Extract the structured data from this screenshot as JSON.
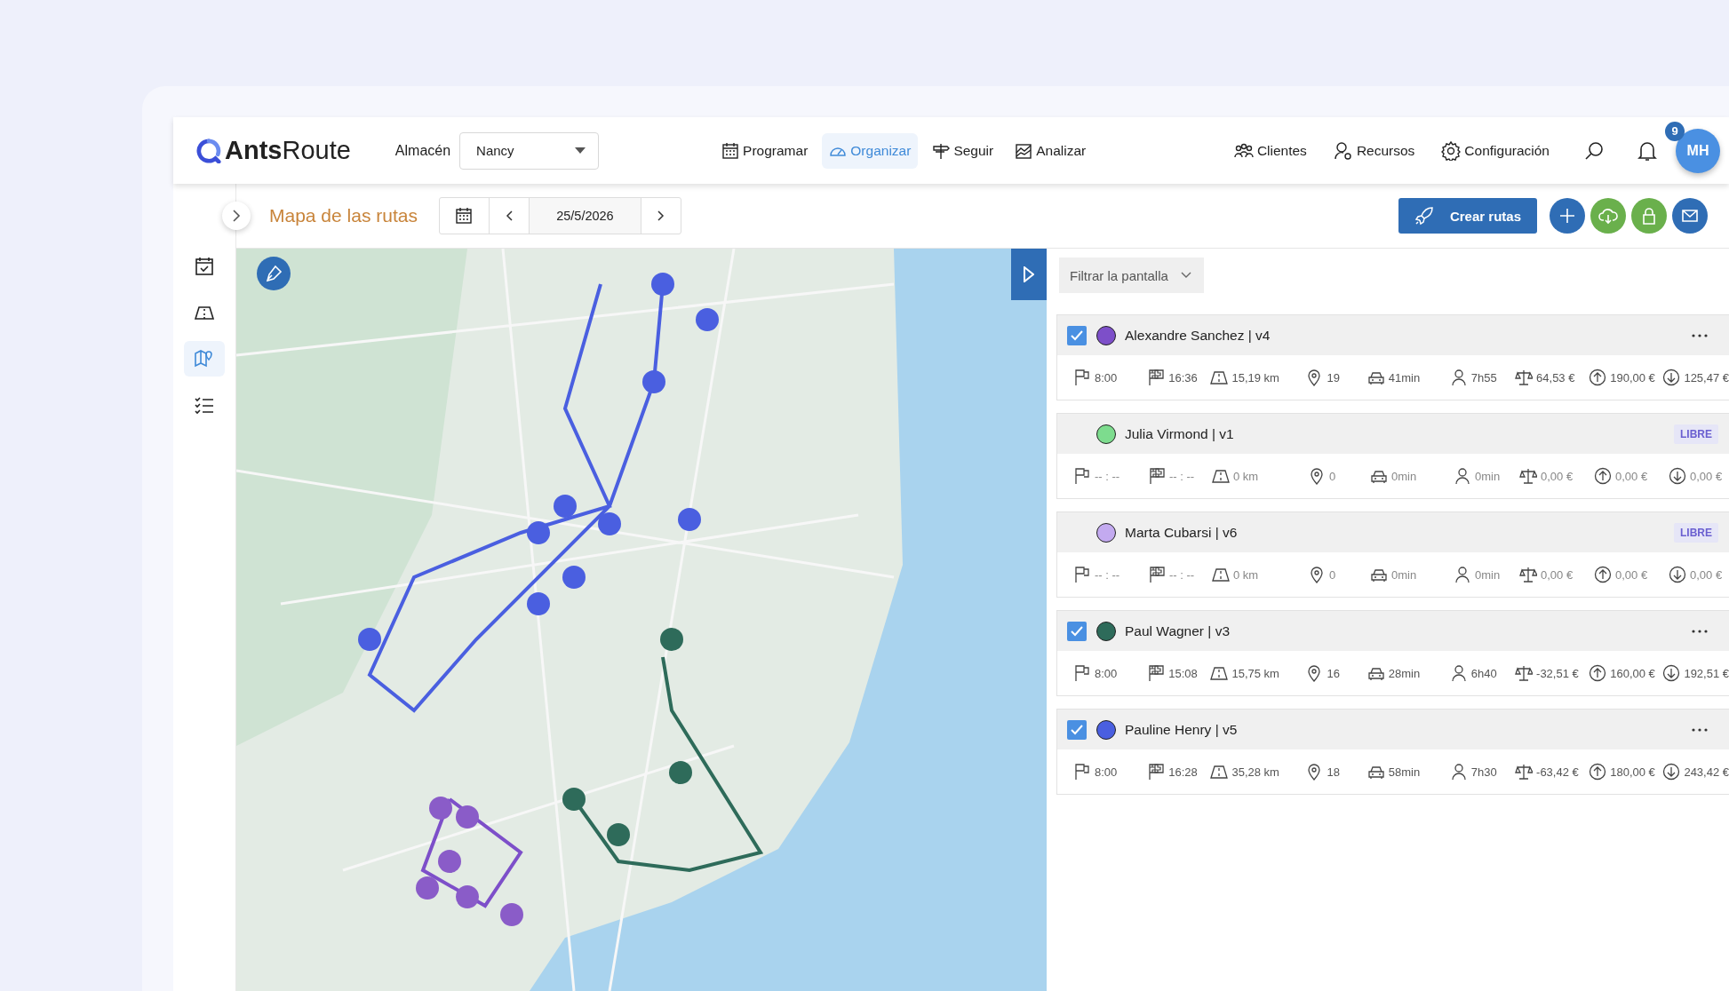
{
  "header": {
    "logo": {
      "strong": "Ants",
      "light": "Route"
    },
    "warehouse_label": "Almacén",
    "warehouse_select": "Nancy",
    "nav": [
      {
        "kind": "calendar",
        "label": "Programar",
        "selected": false
      },
      {
        "kind": "gauge",
        "label": "Organizar",
        "selected": true
      },
      {
        "kind": "signpost",
        "label": "Seguir",
        "selected": false
      },
      {
        "kind": "chart",
        "label": "Analizar",
        "selected": false
      }
    ],
    "right_nav": [
      {
        "kind": "people",
        "label": "Clientes"
      },
      {
        "kind": "user-gear",
        "label": "Recursos"
      },
      {
        "kind": "gear",
        "label": "Configuración"
      }
    ],
    "notifications": "9",
    "avatar": "MH"
  },
  "sidebar": {
    "items": [
      {
        "kind": "calendar-check",
        "selected": false
      },
      {
        "kind": "road",
        "selected": false
      },
      {
        "kind": "map",
        "selected": true
      },
      {
        "kind": "checklist",
        "selected": false
      }
    ]
  },
  "toolbar": {
    "title": "Mapa de las rutas",
    "date": "25/5/2026",
    "create_button": "Crear rutas",
    "actions": [
      {
        "kind": "plus",
        "color": "#2f6db5"
      },
      {
        "kind": "cloud",
        "color": "#6ab04c"
      },
      {
        "kind": "lock",
        "color": "#6ab04c"
      },
      {
        "kind": "mail",
        "color": "#2f6db5"
      }
    ]
  },
  "filter": "Filtrar la pantalla",
  "routes": [
    {
      "name": "Alexandre Sanchez | v4",
      "color": "#7d4fc9",
      "checked": true,
      "stats": {
        "start": "8:00",
        "end": "16:36",
        "distance": "15,19 km",
        "stops": "19",
        "drive": "41min",
        "work": "7h55",
        "balance": "64,53 €",
        "income": "190,00 €",
        "cost": "125,47 €"
      }
    },
    {
      "name": "Julia Virmond | v1",
      "color": "#7ddc8e",
      "checked": false,
      "badge": "LIBRE",
      "stats": {
        "start": "-- : --",
        "end": "-- : --",
        "distance": "0 km",
        "stops": "0",
        "drive": "0min",
        "work": "0min",
        "balance": "0,00 €",
        "income": "0,00 €",
        "cost": "0,00 €"
      }
    },
    {
      "name": "Marta Cubarsi | v6",
      "color": "#c3aaf0",
      "checked": false,
      "badge": "LIBRE",
      "stats": {
        "start": "-- : --",
        "end": "-- : --",
        "distance": "0 km",
        "stops": "0",
        "drive": "0min",
        "work": "0min",
        "balance": "0,00 €",
        "income": "0,00 €",
        "cost": "0,00 €"
      }
    },
    {
      "name": "Paul Wagner | v3",
      "color": "#2e6b5a",
      "checked": true,
      "stats": {
        "start": "8:00",
        "end": "15:08",
        "distance": "15,75 km",
        "stops": "16",
        "drive": "28min",
        "work": "6h40",
        "balance": "-32,51 €",
        "income": "160,00 €",
        "cost": "192,51 €"
      }
    },
    {
      "name": "Pauline Henry | v5",
      "color": "#4a5fe0",
      "checked": true,
      "stats": {
        "start": "8:00",
        "end": "16:28",
        "distance": "35,28 km",
        "stops": "18",
        "drive": "58min",
        "work": "7h30",
        "balance": "-63,42 €",
        "income": "180,00 €",
        "cost": "243,42 €"
      }
    }
  ]
}
